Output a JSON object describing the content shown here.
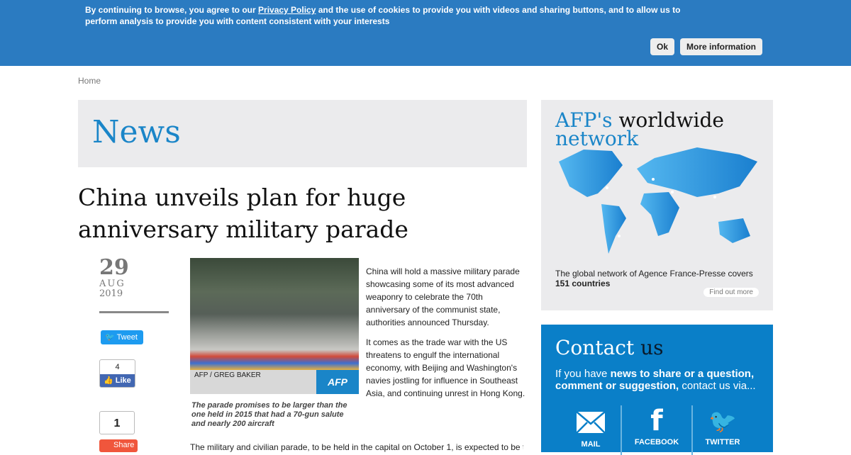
{
  "cookie": {
    "text_before": "By continuing to browse, you agree to our ",
    "link": "Privacy Policy",
    "text_after": " and the use of cookies to provide you with videos and sharing buttons, and to allow us to perform analysis to provide you with content consistent with your interests",
    "ok": "Ok",
    "more": "More information"
  },
  "breadcrumb": "Home",
  "section_title": "News",
  "article": {
    "title": "China unveils plan for huge anniversary military parade",
    "date": {
      "day": "29",
      "month": "AUG",
      "year": "2019"
    },
    "social": {
      "tweet": "Tweet",
      "like_count": "4",
      "like": "Like",
      "share_count": "1",
      "share": "Share"
    },
    "photo_credit": "AFP / GREG BAKER",
    "photo_logo": "AFP",
    "caption": "The parade promises to be larger than the one held in 2015 that had a 70-gun salute and nearly 200 aircraft",
    "paragraphs": [
      "China will hold a massive military parade showcasing some of its most advanced weaponry to celebrate the 70th anniversary of the communist state, authorities announced Thursday.",
      "It comes as the trade war with the US threatens to engulf the international economy, with Beijing and Washington's navies jostling for influence in Southeast Asia, and continuing unrest in Hong Kong."
    ],
    "continued": "The military and civilian parade, to be held in the capital on October 1, is expected to be the"
  },
  "network": {
    "title_blue": "AFP's",
    "title_dark": " worldwide",
    "title_line2": "network",
    "desc": "The global network of Agence France-Presse covers ",
    "desc_bold": "151 countries",
    "link": "Find out more"
  },
  "contact": {
    "title": "Contact ",
    "title_dark": "us",
    "desc_1": "If you have ",
    "desc_bold": "news to share or a question, comment or suggestion,",
    "desc_2": " contact us via...",
    "channels": [
      "MAIL",
      "FACEBOOK",
      "TWITTER"
    ]
  },
  "colors": {
    "banner": "#2b7bc1",
    "accent": "#1a85c8",
    "contact_bg": "#0a7fc8"
  }
}
